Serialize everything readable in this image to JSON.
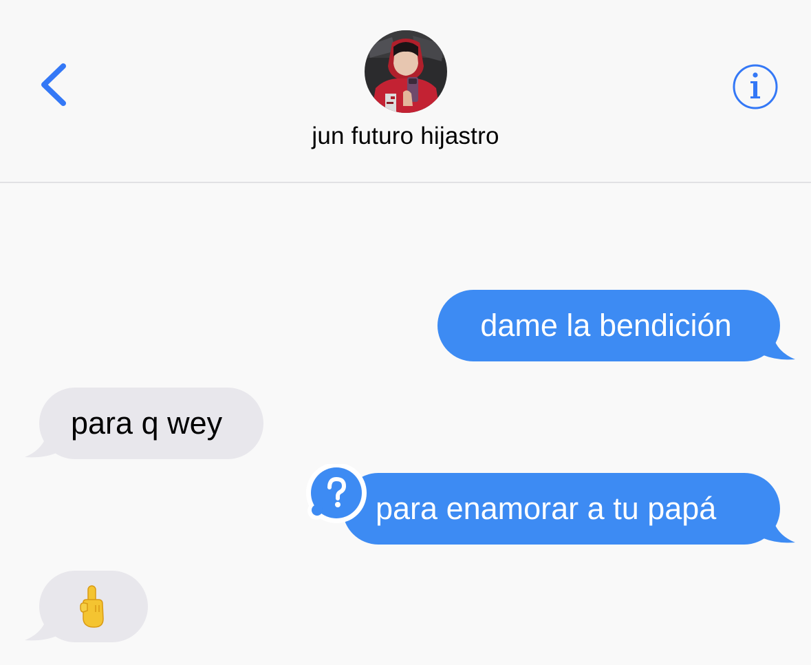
{
  "header": {
    "contact_name": "jun futuro hijastro",
    "back_icon": "chevron-left-icon",
    "info_icon": "info-circle-icon"
  },
  "messages": [
    {
      "direction": "sent",
      "text": "dame la bendición"
    },
    {
      "direction": "received",
      "text": "para q wey"
    },
    {
      "direction": "sent",
      "text": "para enamorar a tu papá",
      "status_icon": "question-mark-badge-icon"
    },
    {
      "direction": "received",
      "emoji": "middle-finger-emoji"
    }
  ],
  "colors": {
    "accent_blue": "#3d8bf3",
    "received_gray": "#e8e7ec",
    "background": "#f9f9f9"
  }
}
